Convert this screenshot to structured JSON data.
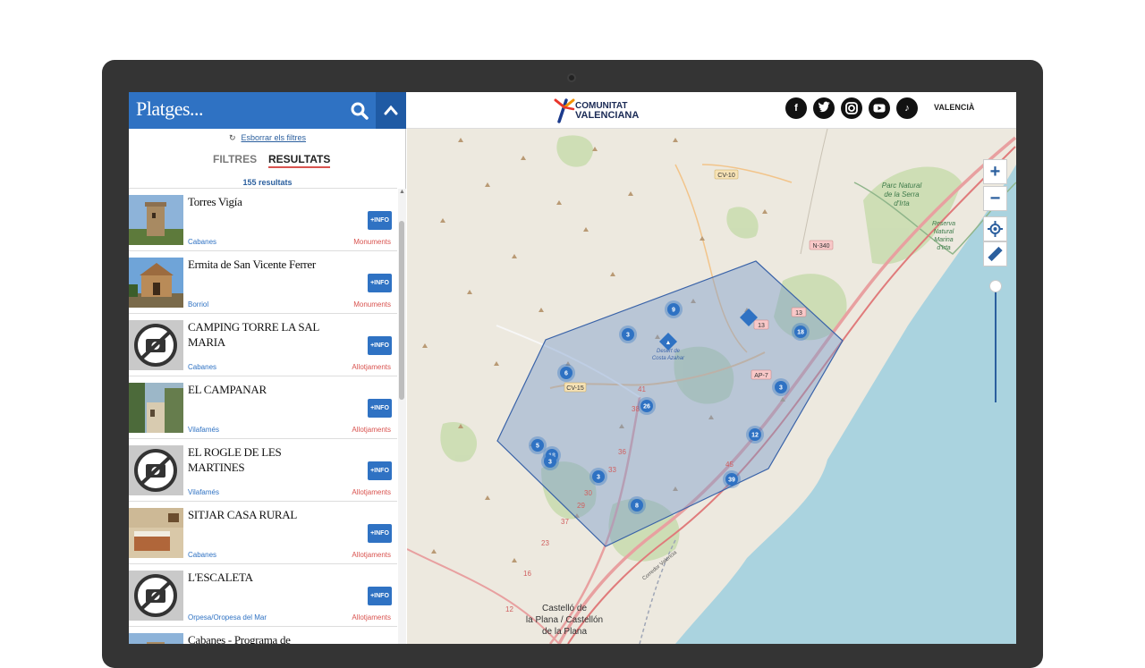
{
  "search": {
    "text": "Platges..."
  },
  "filters": {
    "reset_label": "Esborrar els filtres",
    "tab_filters": "FILTRES",
    "tab_results": "RESULTATS",
    "count": "155 resultats"
  },
  "results": [
    {
      "title": "Torres Vigía",
      "location": "Cabanes",
      "category": "Monuments",
      "info": "+INFO",
      "image": "tower-photo"
    },
    {
      "title": "Ermita de San Vicente Ferrer",
      "location": "Borriol",
      "category": "Monuments",
      "info": "+INFO",
      "image": "hermitage-photo"
    },
    {
      "title": "CAMPING TORRE LA SAL MARIA",
      "location": "Cabanes",
      "category": "Allotjaments",
      "info": "+INFO",
      "image": "no-photo-icon"
    },
    {
      "title": "EL CAMPANAR",
      "location": "Vilafamés",
      "category": "Allotjaments",
      "info": "+INFO",
      "image": "village-photo"
    },
    {
      "title": "EL ROGLE DE LES MARTINES",
      "location": "Vilafamés",
      "category": "Allotjaments",
      "info": "+INFO",
      "image": "no-photo-icon"
    },
    {
      "title": "SITJAR CASA RURAL",
      "location": "Cabanes",
      "category": "Allotjaments",
      "info": "+INFO",
      "image": "room-photo"
    },
    {
      "title": "L'ESCALETA",
      "location": "Orpesa/Oropesa del Mar",
      "category": "Allotjaments",
      "info": "+INFO",
      "image": "no-photo-icon"
    },
    {
      "title": "Cabanes - Programa de",
      "location": "",
      "category": "",
      "info": "",
      "image": "tower-photo"
    }
  ],
  "header": {
    "logo_line1": "COMUNITAT",
    "logo_line2": "VALENCIANA",
    "language": "VALENCIÀ",
    "social": [
      "facebook-icon",
      "twitter-icon",
      "instagram-icon",
      "youtube-icon",
      "tiktok-icon"
    ]
  },
  "map": {
    "labels": {
      "cv10": "CV-10",
      "cv15": "CV-15",
      "n340": "N-340",
      "ap7": "AP-7",
      "n13": "13",
      "n13b": "13",
      "park1": "Parc Natural",
      "park2": "de la Serra",
      "park3": "d'Irta",
      "res1": "Reserva",
      "res2": "Natural",
      "res3": "Marina",
      "res4": "d'Irta",
      "city1": "Castelló de",
      "city2": "la Plana / Castellón",
      "city3": "de la Plana",
      "poi1": "Desert de",
      "poi2": "Costa Azahar",
      "rail": "Corredor Valencia",
      "km41": "41",
      "km38": "38",
      "km36": "36",
      "km33": "33",
      "km30": "30",
      "km29": "29",
      "km45": "45",
      "km37": "37",
      "km23": "23",
      "km16": "16",
      "km12": "12"
    },
    "clusters": [
      "9",
      "3",
      "18",
      "6",
      "3",
      "26",
      "5",
      "18",
      "3",
      "12",
      "3",
      "39",
      "8"
    ],
    "zoom_in": "+",
    "zoom_out": "−"
  },
  "colors": {
    "accent": "#2f72c3",
    "header_dark": "#1f5aa4",
    "category": "#d9534f",
    "sea": "#aad3df",
    "land": "#ede9df",
    "polygon": "#7b9bcc"
  }
}
